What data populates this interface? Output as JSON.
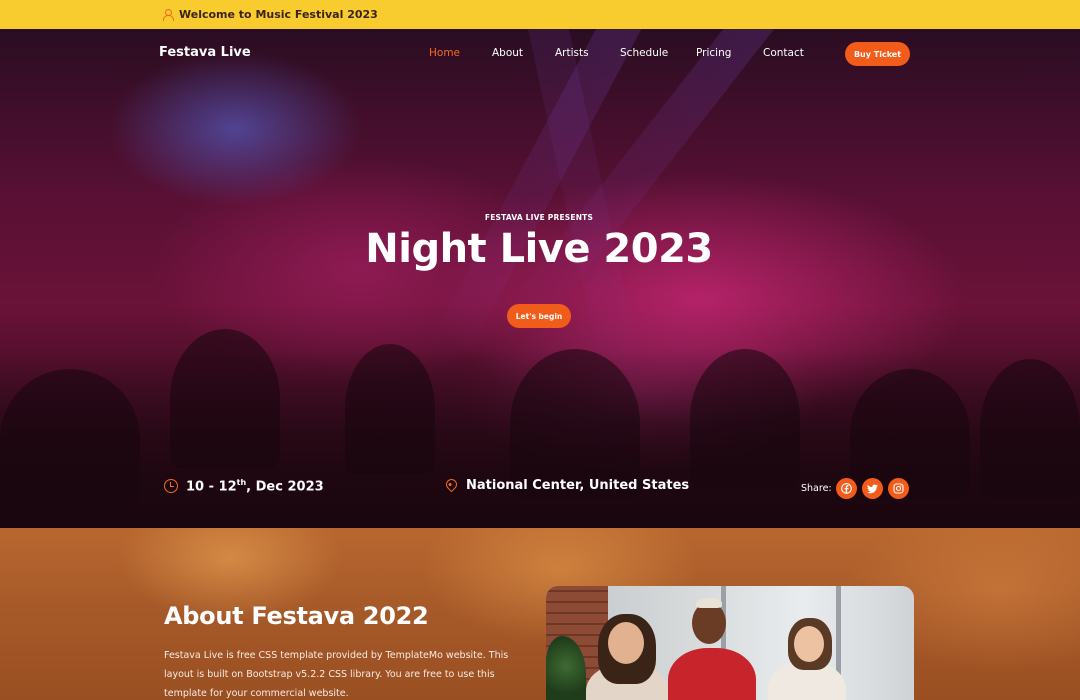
{
  "topbar": {
    "text": "Welcome to Music Festival 2023"
  },
  "nav": {
    "brand": "Festava Live",
    "links": [
      {
        "label": "Home",
        "active": true
      },
      {
        "label": "About",
        "active": false
      },
      {
        "label": "Artists",
        "active": false
      },
      {
        "label": "Schedule",
        "active": false
      },
      {
        "label": "Pricing",
        "active": false
      },
      {
        "label": "Contact",
        "active": false
      }
    ],
    "cta": "Buy Ticket"
  },
  "hero": {
    "kicker": "FESTAVA LIVE PRESENTS",
    "title": "Night Live 2023",
    "button": "Let's begin",
    "date": {
      "day_start": "10 - 12",
      "suffix": "th",
      "rest": ", Dec 2023"
    },
    "location": "National Center, United States",
    "share_label": "Share:",
    "social": [
      "facebook-icon",
      "twitter-icon",
      "instagram-icon"
    ]
  },
  "about": {
    "title": "About Festava 2022",
    "text": "Festava Live is free CSS template provided by TemplateMo website. This layout is built on Bootstrap v5.2.2 CSS library. You are free to use this template for your commercial website."
  },
  "colors": {
    "accent": "#f25c1a",
    "topbar": "#f8cb2e"
  }
}
